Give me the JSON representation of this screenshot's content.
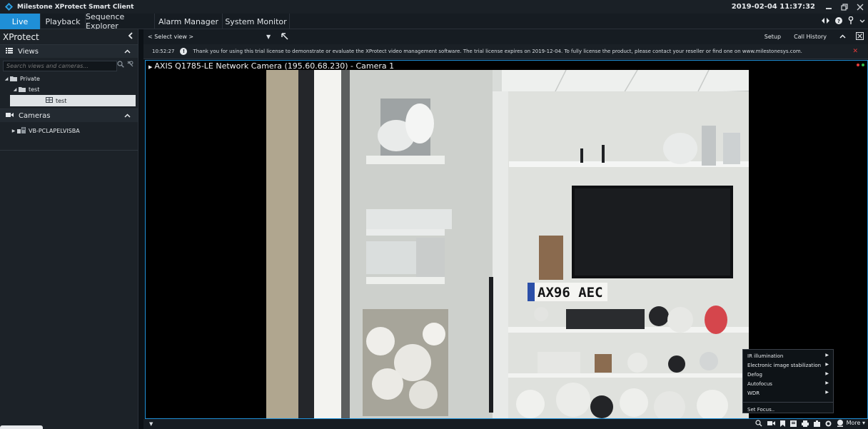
{
  "app": {
    "title": "Milestone XProtect Smart Client",
    "datetime": "2019-02-04 11:37:32"
  },
  "tabs": [
    {
      "label": "Live"
    },
    {
      "label": "Playback"
    },
    {
      "label": "Sequence Explorer"
    },
    {
      "label": "Alarm Manager"
    },
    {
      "label": "System Monitor"
    }
  ],
  "sidebar": {
    "title": "XProtect",
    "views_label": "Views",
    "search_placeholder": "Search views and cameras...",
    "tree": {
      "private": "Private",
      "group": "test",
      "view": "test"
    },
    "cameras_label": "Cameras",
    "server": "VB-PCLAPELVISBA"
  },
  "toolbar": {
    "select_view": "< Select view >",
    "setup": "Setup",
    "call_history": "Call History"
  },
  "info": {
    "time": "10:52:27",
    "message": "Thank you for using this trial license to demonstrate or evaluate the XProtect video management software. The trial license expires on 2019-12-04. To fully license the product, please contact your reseller or find one on www.milestonesys.com."
  },
  "camera": {
    "title": "AXIS Q1785-LE Network Camera (195.60.68.230) - Camera 1",
    "plate": "AX96 AEC"
  },
  "context_menu": {
    "items": [
      "IR illumination",
      "Electronic image stabilization",
      "Defog",
      "Autofocus",
      "WDR"
    ],
    "set_focus": "Set Focus.."
  },
  "bottom": {
    "more": "More"
  },
  "colors": {
    "accent": "#1f8fd7",
    "status_red": "#e53b3b",
    "status_green": "#2fbf4a"
  }
}
